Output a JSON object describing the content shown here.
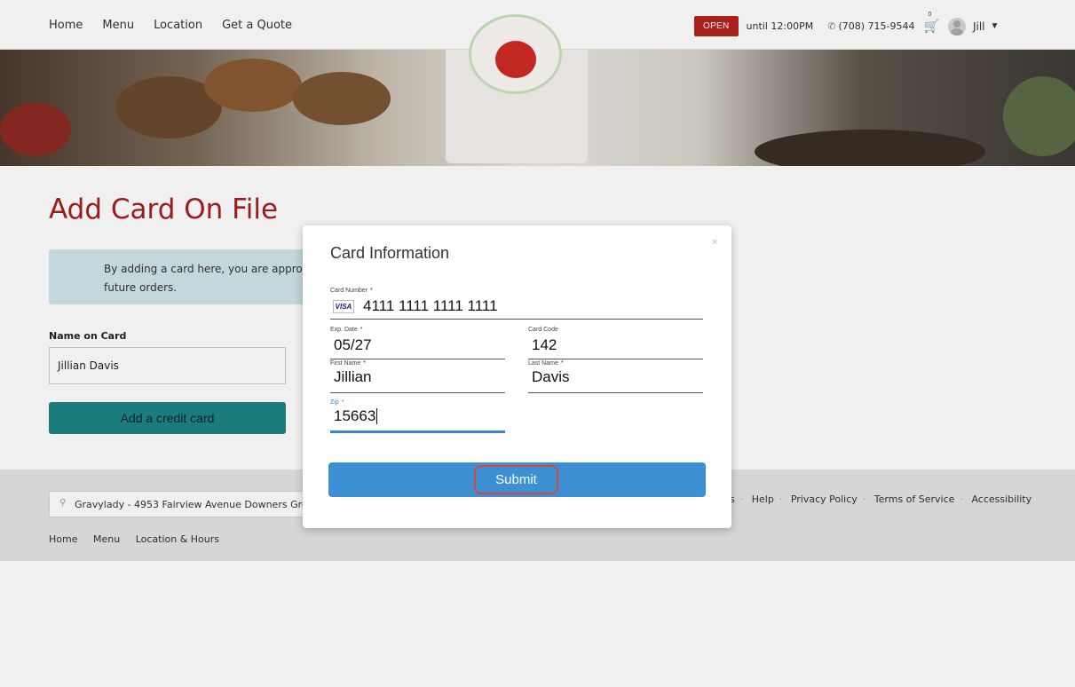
{
  "header": {
    "nav": [
      "Home",
      "Menu",
      "Location",
      "Get a Quote"
    ],
    "status_badge": "OPEN",
    "hours": "until 12:00PM",
    "phone": "(708) 715-9544",
    "cart_count": "0",
    "user_name": "Jill"
  },
  "page": {
    "title": "Add Card On File",
    "notice": "By adding a card here, you are approvi future orders.",
    "name_label": "Name on Card",
    "name_value": "Jillian Davis",
    "add_card_label": "Add a credit card"
  },
  "footer": {
    "address": "Gravylady - 4953 Fairview Avenue Downers Grove,",
    "nav": [
      "Home",
      "Menu",
      "Location & Hours"
    ],
    "links": [
      "s",
      "Help",
      "Privacy Policy",
      "Terms of Service",
      "Accessibility"
    ]
  },
  "modal": {
    "title": "Card Information",
    "close": "×",
    "card_number_label": "Card Number",
    "card_brand": "VISA",
    "card_number": "4111 1111 1111 1111",
    "exp_label": "Exp. Date",
    "exp_value": "05/27",
    "code_label": "Card Code",
    "code_value": "142",
    "first_label": "First Name",
    "first_value": "Jillian",
    "last_label": "Last Name",
    "last_value": "Davis",
    "zip_label": "Zip",
    "zip_value": "15663",
    "required_mark": "*",
    "submit_label": "Submit"
  },
  "colors": {
    "open_badge": "#b3241f",
    "page_title": "#a51e1e",
    "teal_button": "#1d8583",
    "submit_button": "#3c8fd3",
    "zip_focus": "#3a86c8",
    "highlight_outline": "#d3493a"
  }
}
